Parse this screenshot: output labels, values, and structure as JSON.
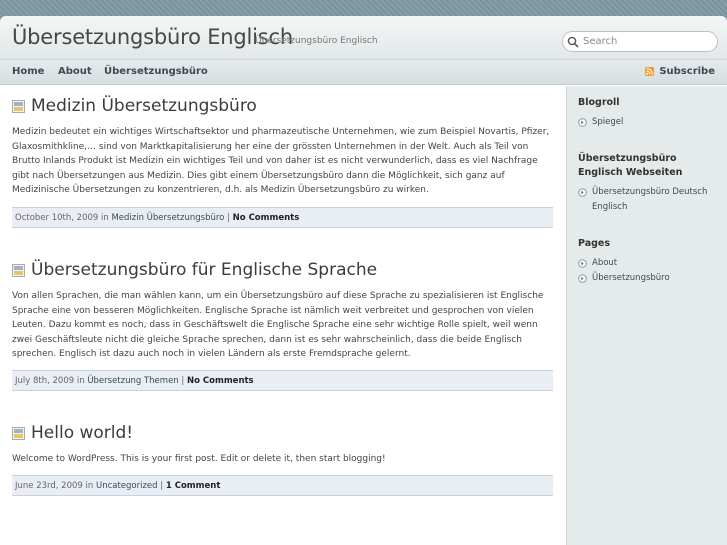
{
  "site": {
    "title": "Übersetzungsbüro Englisch",
    "description": "Übersetzungsbüro Englisch"
  },
  "search": {
    "placeholder": "Search"
  },
  "nav": {
    "items": [
      {
        "label": "Home"
      },
      {
        "label": "About"
      },
      {
        "label": "Übersetzungsbüro"
      }
    ],
    "subscribe_label": "Subscribe"
  },
  "posts": [
    {
      "title": "Medizin Übersetzungsbüro",
      "body": "Medizin bedeutet ein wichtiges Wirtschaftsektor und pharmazeutische Unternehmen, wie zum Beispiel Novartis, Pfizer, Glaxosmithkline,… sind von Marktkapitalisierung her eine der grössten Unternehmen in der Welt. Auch als Teil von Brutto Inlands Produkt ist Medizin ein wichtiges Teil und von daher ist es nicht verwunderlich, dass es viel Nachfrage gibt nach Übersetzungen aus Medizin. Dies gibt einem Übersetzungsbüro dann die Möglichkeit, sich ganz auf Medizinische Übersetzungen zu konzentrieren, d.h. als Medizin Übersetzungsbüro zu wirken.",
      "date": "October 10th, 2009",
      "in_label": "in",
      "category": "Medizin Übersetzungsbüro",
      "separator": "|",
      "comments": "No Comments"
    },
    {
      "title": "Übersetzungsbüro für Englische Sprache",
      "body": "Von allen Sprachen, die man wählen kann, um ein Übersetzungsbüro auf diese Sprache zu spezialisieren ist Englische Sprache eine von besseren Möglichkeiten. Englische Sprache ist nämlich weit verbreitet und gesprochen von vielen Leuten. Dazu kommt es noch, dass in Geschäftswelt die Englische Sprache eine sehr wichtige Rolle spielt, weil wenn zwei Geschäftsleute nicht die gleiche Sprache sprechen, dann ist es sehr wahrscheinlich, dass die beide Englisch sprechen. Englisch ist dazu auch noch in vielen Ländern als erste Fremdsprache gelernt.",
      "date": "July 8th, 2009",
      "in_label": "in",
      "category": "Übersetzung Themen",
      "separator": "|",
      "comments": "No Comments"
    },
    {
      "title": "Hello world!",
      "body": "Welcome to WordPress. This is your first post. Edit or delete it, then start blogging!",
      "date": "June 23rd, 2009",
      "in_label": "in",
      "category": "Uncategorized",
      "separator": "|",
      "comments": "1 Comment"
    }
  ],
  "sidebar": {
    "widgets": [
      {
        "title": "Blogroll",
        "items": [
          {
            "label": "Spiegel"
          }
        ]
      },
      {
        "title": "Übersetzungsbüro Englisch Webseiten",
        "items": [
          {
            "label": "Übersetzungsbüro Deutsch Englisch"
          }
        ]
      },
      {
        "title": "Pages",
        "items": [
          {
            "label": "About"
          },
          {
            "label": "Übersetzungsbüro"
          }
        ]
      }
    ]
  },
  "colors": {
    "outer_background": "#7f99a3",
    "header_background": "#eaeeef",
    "sidebar_background": "#e5eaeb",
    "meta_bar_background": "#e9eef5",
    "link_color": "#3b4a55",
    "rss_orange": "#f39c33"
  },
  "icons": {
    "search": "search-icon",
    "subscribe": "rss-icon",
    "post": "post-icon",
    "list_bullet": "circle-arrow-icon"
  }
}
